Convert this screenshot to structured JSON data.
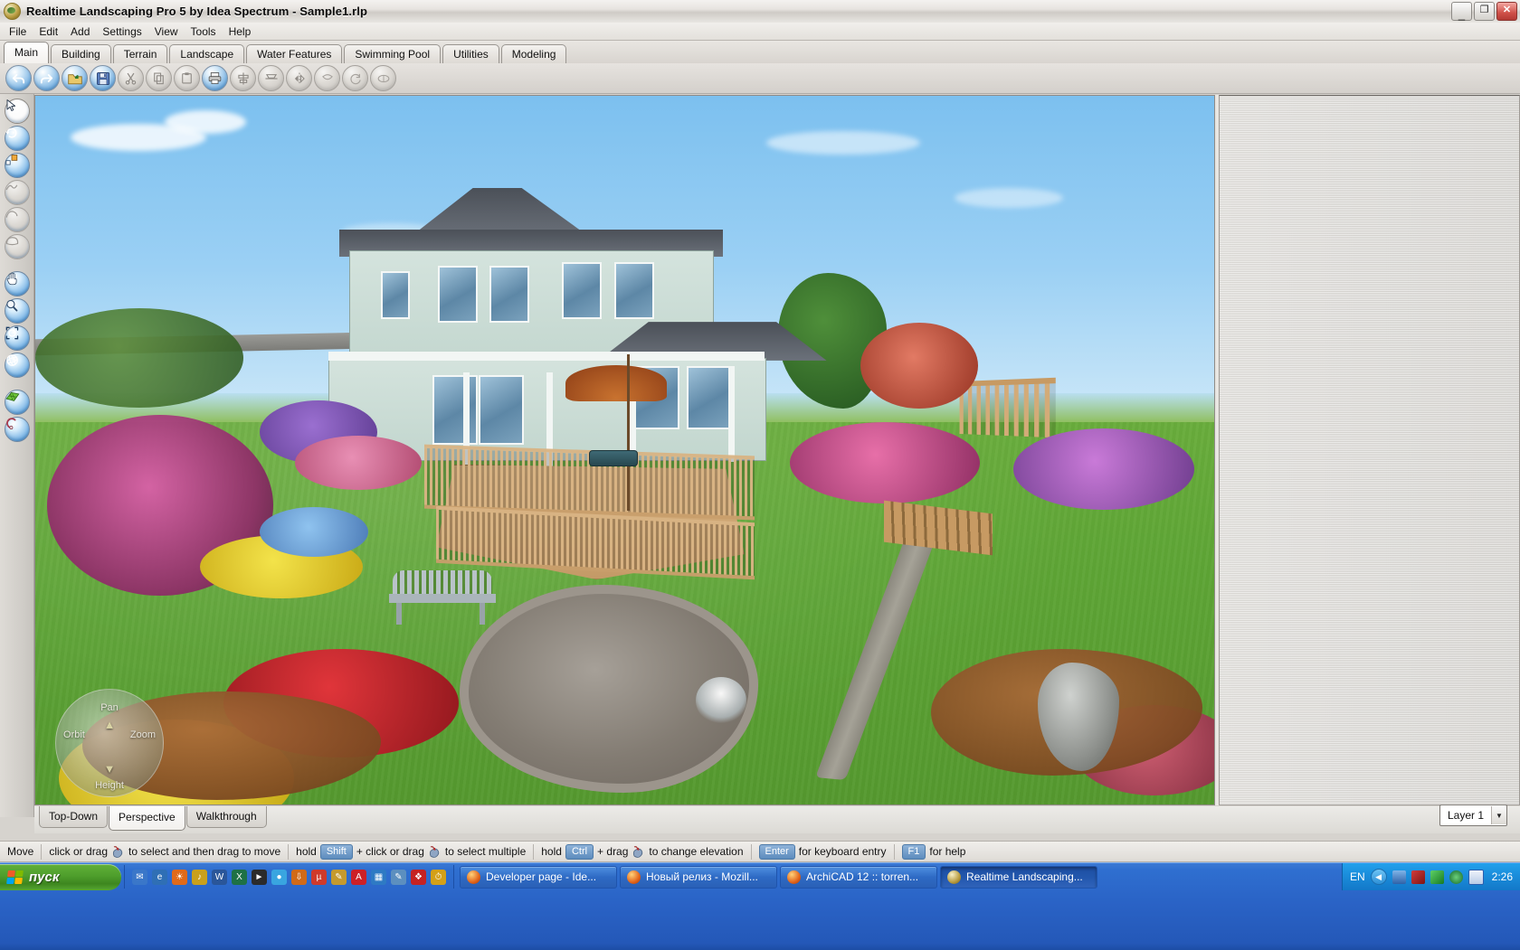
{
  "window": {
    "title": "Realtime Landscaping Pro 5 by Idea Spectrum - Sample1.rlp",
    "app_icon": "globe-landscape-icon",
    "minimize_label": "_",
    "maximize_label": "❐",
    "close_label": "✕"
  },
  "menu": {
    "items": [
      {
        "label": "File"
      },
      {
        "label": "Edit"
      },
      {
        "label": "Add"
      },
      {
        "label": "Settings"
      },
      {
        "label": "View"
      },
      {
        "label": "Tools"
      },
      {
        "label": "Help"
      }
    ]
  },
  "ribbon_tabs": {
    "active": "Main",
    "items": [
      {
        "label": "Main"
      },
      {
        "label": "Building"
      },
      {
        "label": "Terrain"
      },
      {
        "label": "Landscape"
      },
      {
        "label": "Water Features"
      },
      {
        "label": "Swimming Pool"
      },
      {
        "label": "Utilities"
      },
      {
        "label": "Modeling"
      }
    ]
  },
  "toolbar": {
    "buttons": [
      {
        "name": "undo-icon",
        "label": "Undo",
        "enabled": true
      },
      {
        "name": "redo-icon",
        "label": "Redo",
        "enabled": true
      },
      {
        "name": "open-folder-icon",
        "label": "Open",
        "enabled": true
      },
      {
        "name": "save-icon",
        "label": "Save",
        "enabled": true
      },
      {
        "name": "cut-icon",
        "label": "Cut",
        "enabled": false
      },
      {
        "name": "copy-icon",
        "label": "Copy",
        "enabled": false
      },
      {
        "name": "paste-icon",
        "label": "Paste",
        "enabled": false
      },
      {
        "name": "print-icon",
        "label": "Print",
        "enabled": true
      },
      {
        "name": "align-icon",
        "label": "Align",
        "enabled": false
      },
      {
        "name": "distribute-icon",
        "label": "Distribute",
        "enabled": false
      },
      {
        "name": "mirror-icon",
        "label": "Mirror",
        "enabled": false
      },
      {
        "name": "group-icon",
        "label": "Group",
        "enabled": false
      },
      {
        "name": "rotate-icon",
        "label": "Rotate",
        "enabled": false
      },
      {
        "name": "scale-icon",
        "label": "Scale",
        "enabled": false
      }
    ]
  },
  "tool_rail": {
    "tools": [
      {
        "name": "select-arrow-icon",
        "label": "Select",
        "state": "selected"
      },
      {
        "name": "rotate-object-icon",
        "label": "Rotate",
        "state": "normal"
      },
      {
        "name": "resize-object-icon",
        "label": "Resize",
        "state": "normal"
      },
      {
        "name": "polyline-icon",
        "label": "Polyline",
        "state": "disabled"
      },
      {
        "name": "curve-icon",
        "label": "Curve",
        "state": "disabled"
      },
      {
        "name": "region-icon",
        "label": "Region",
        "state": "disabled"
      },
      {
        "name": "pan-hand-icon",
        "label": "Pan",
        "state": "normal"
      },
      {
        "name": "zoom-icon",
        "label": "Zoom",
        "state": "normal"
      },
      {
        "name": "zoom-extents-icon",
        "label": "Zoom Extents",
        "state": "normal"
      },
      {
        "name": "orbit-icon",
        "label": "Orbit",
        "state": "normal"
      },
      {
        "name": "grid-icon",
        "label": "Grid",
        "state": "normal"
      },
      {
        "name": "measure-icon",
        "label": "Measure",
        "state": "normal"
      }
    ]
  },
  "viewport": {
    "compass": {
      "orbit_label": "Orbit",
      "zoom_label": "Zoom",
      "pan_label": "Pan",
      "height_label": "Height"
    },
    "scene_description": "3D perspective rendering of a two-story house with wooden deck, patio umbrella, flower beds, rock pond with fountain, pergola and park bench"
  },
  "view_tabs": {
    "active": "Perspective",
    "items": [
      {
        "label": "Top-Down"
      },
      {
        "label": "Perspective"
      },
      {
        "label": "Walkthrough"
      }
    ],
    "layer_selector": {
      "name": "layer-dropdown",
      "value": "Layer 1",
      "caret": "▼"
    }
  },
  "status_bar": {
    "mode_label": "Move",
    "segments": [
      {
        "pre": "click or drag",
        "icon": "mouse-icon",
        "post": "to select and then drag to move",
        "key": ""
      },
      {
        "pre": "hold",
        "key": "Shift",
        "mid": "+ click or drag",
        "icon": "mouse-icon",
        "post": "to select multiple"
      },
      {
        "pre": "hold",
        "key": "Ctrl",
        "mid": "+ drag",
        "icon": "mouse-icon",
        "post": "to change elevation"
      },
      {
        "pre": "",
        "key": "Enter",
        "post": "for keyboard entry"
      },
      {
        "pre": "",
        "key": "F1",
        "post": "for help"
      }
    ]
  },
  "taskbar": {
    "start_label": "пуск",
    "quick_launch": [
      {
        "name": "outlook-express-icon",
        "color": "#3a77c9"
      },
      {
        "name": "internet-explorer-icon",
        "color": "#2f6fb5"
      },
      {
        "name": "firefox-icon",
        "color": "#e06a1a"
      },
      {
        "name": "winamp-icon",
        "color": "#c9a01c"
      },
      {
        "name": "word-icon",
        "color": "#2a5699"
      },
      {
        "name": "excel-icon",
        "color": "#1e7145"
      },
      {
        "name": "media-player-icon",
        "color": "#2b2b2b"
      },
      {
        "name": "messenger-icon",
        "color": "#39a5e0"
      },
      {
        "name": "download-manager-icon",
        "color": "#d06a18"
      },
      {
        "name": "utorrent-icon",
        "color": "#cf3a2b"
      },
      {
        "name": "notes-icon",
        "color": "#c59a2e"
      },
      {
        "name": "acrobat-icon",
        "color": "#cc2027"
      },
      {
        "name": "usb-icon",
        "color": "#2e7ac4"
      },
      {
        "name": "paint-icon",
        "color": "#5c8fbf"
      },
      {
        "name": "abbyy-icon",
        "color": "#c52222"
      },
      {
        "name": "clock-icon",
        "color": "#d4a017"
      }
    ],
    "tasks": [
      {
        "label": "Developer page - Ide...",
        "icon": "firefox-icon",
        "active": false
      },
      {
        "label": "Новый релиз - Mozill...",
        "icon": "firefox-icon",
        "active": false
      },
      {
        "label": "ArchiCAD 12 :: torren...",
        "icon": "firefox-icon",
        "active": false
      },
      {
        "label": "Realtime Landscaping...",
        "icon": "globe-landscape-icon",
        "active": true
      }
    ],
    "tray": {
      "language": "EN",
      "show_hidden_label": "◀",
      "icons": [
        {
          "name": "network-icon",
          "color": "#3f72b8"
        },
        {
          "name": "antivirus-icon",
          "color": "#c02020"
        },
        {
          "name": "power-icon",
          "color": "#1f9c3f"
        },
        {
          "name": "updates-icon",
          "color": "#2f9a4a"
        },
        {
          "name": "mail-icon",
          "color": "#2a5fb0"
        }
      ],
      "clock": "2:26"
    }
  },
  "colors": {
    "accent_blue": "#2a63c6",
    "title_bar": "#e7e4e0",
    "chrome": "#d6d3ce",
    "lawn_green": "#5fa636",
    "sky_blue": "#9bd0f4",
    "deck_wood": "#d8b281",
    "close_red": "#cf5048"
  }
}
